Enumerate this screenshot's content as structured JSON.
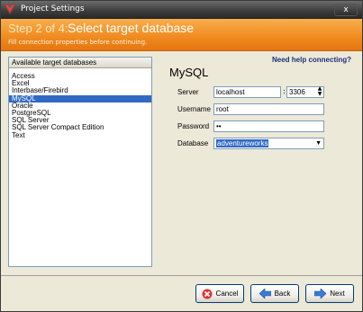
{
  "window": {
    "title": "Project Settings",
    "close_label": "x"
  },
  "header": {
    "step": "Step 2 of 4:",
    "title": "Select target database",
    "subtitle": "Fill connection properties before continuing."
  },
  "help_link": "Need help connecting?",
  "db_list": {
    "header": "Available target databases",
    "items": [
      {
        "label": "Access",
        "selected": false
      },
      {
        "label": "Excel",
        "selected": false
      },
      {
        "label": "Interbase/Firebird",
        "selected": false
      },
      {
        "label": "MySQL",
        "selected": true
      },
      {
        "label": "Oracle",
        "selected": false
      },
      {
        "label": "PostgreSQL",
        "selected": false
      },
      {
        "label": "SQL Server",
        "selected": false
      },
      {
        "label": "SQL Server Compact Edition",
        "selected": false
      },
      {
        "label": "Text",
        "selected": false
      }
    ]
  },
  "form": {
    "db_name": "MySQL",
    "server_label": "Server",
    "server_value": "localhost",
    "port_separator": ":",
    "port_value": "3306",
    "username_label": "Username",
    "username_value": "root",
    "password_label": "Password",
    "password_value": "••",
    "database_label": "Database",
    "database_value": "adventureworks"
  },
  "buttons": {
    "cancel": "Cancel",
    "back": "Back",
    "next": "Next"
  },
  "colors": {
    "header_orange": "#f08a1e",
    "selection_blue": "#316ac5",
    "help_link": "#1e2f7a"
  }
}
